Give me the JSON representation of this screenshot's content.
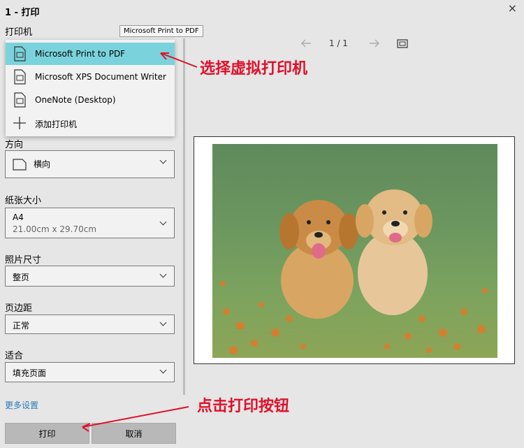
{
  "dialog": {
    "title": "1 - 打印",
    "close": "×"
  },
  "printer": {
    "label": "打印机",
    "tooltip": "Microsoft Print to PDF",
    "options": [
      {
        "label": "Microsoft Print to PDF",
        "icon": "printer-doc-icon",
        "selected": true
      },
      {
        "label": "Microsoft XPS Document Writer",
        "icon": "printer-doc-icon"
      },
      {
        "label": "OneNote (Desktop)",
        "icon": "printer-doc-icon"
      },
      {
        "label": "添加打印机",
        "icon": "plus-icon"
      }
    ]
  },
  "orientation": {
    "label": "方向",
    "value": "横向",
    "icon": "page-icon"
  },
  "paper_size": {
    "label": "纸张大小",
    "value": "A4",
    "subvalue": "21.00cm x 29.70cm"
  },
  "photo_size": {
    "label": "照片尺寸",
    "value": "整页"
  },
  "margins": {
    "label": "页边距",
    "value": "正常"
  },
  "fit": {
    "label": "适合",
    "value": "填充页面"
  },
  "more_settings": "更多设置",
  "buttons": {
    "print": "打印",
    "cancel": "取消"
  },
  "preview": {
    "page_indicator": "1 / 1",
    "prev_icon": "arrow-left-icon",
    "next_icon": "arrow-right-icon",
    "fit_icon": "fit-screen-icon",
    "image_subject": "two golden retriever puppies on grass with orange flowers"
  },
  "annotations": {
    "select_printer": "选择虚拟打印机",
    "click_print": "点击打印按钮"
  },
  "colors": {
    "accent_selected": "#7ad3dc",
    "annotation_red": "#e0102a",
    "link_blue": "#2b7bb8"
  }
}
